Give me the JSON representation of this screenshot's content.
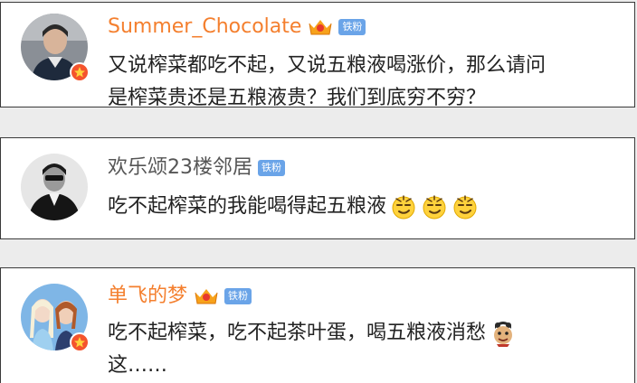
{
  "colors": {
    "vip_name": "#f47f2e",
    "normal_name": "#555555",
    "fan_badge": "#6aa4e8",
    "verified_badge": "#f4542d",
    "comment_text": "#222222"
  },
  "comments": [
    {
      "username": "Summer_Chocolate",
      "vip": true,
      "crown_icon": "vip-crown-icon",
      "fan_badge": "铁粉",
      "verified": true,
      "avatar_icon": "user-avatar-portrait",
      "lines": [
        "又说榨菜都吃不起，又说五粮液喝涨价，那么请问",
        "是榨菜贵还是五粮液贵？我们到底穷不穷？"
      ]
    },
    {
      "username": "欢乐颂23楼邻居",
      "vip": false,
      "fan_badge": "铁粉",
      "verified": false,
      "avatar_icon": "user-avatar-bw-portrait",
      "lines": [
        "吃不起榨菜的我能喝得起五粮液"
      ],
      "emojis": [
        "smirk-emoji",
        "smirk-emoji",
        "smirk-emoji"
      ]
    },
    {
      "username": "单飞的梦",
      "vip": true,
      "crown_icon": "vip-crown-icon",
      "fan_badge": "铁粉",
      "verified": true,
      "avatar_icon": "user-avatar-frozen",
      "lines": [
        "吃不起榨菜，吃不起茶叶蛋，喝五粮液消愁",
        "这……"
      ],
      "emojis": [
        "cartoon-face-emoji"
      ]
    }
  ]
}
